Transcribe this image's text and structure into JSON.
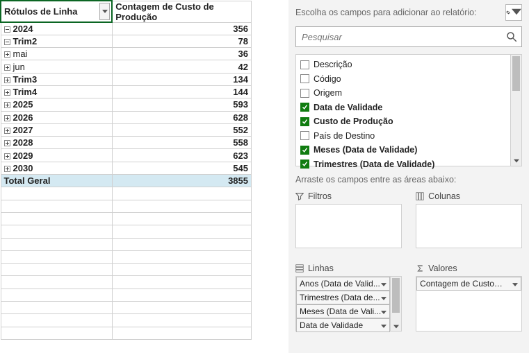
{
  "pivot": {
    "header_row": "Rótulos de Linha",
    "header_value": "Contagem de Custo de Produção",
    "rows": [
      {
        "label": "2024",
        "value": "356",
        "indent": 0,
        "icon": "minus",
        "bold": true
      },
      {
        "label": "Trim2",
        "value": "78",
        "indent": 1,
        "icon": "minus",
        "bold": true
      },
      {
        "label": "mai",
        "value": "36",
        "indent": 2,
        "icon": "plus",
        "bold": false
      },
      {
        "label": "jun",
        "value": "42",
        "indent": 2,
        "icon": "plus",
        "bold": false
      },
      {
        "label": "Trim3",
        "value": "134",
        "indent": 1,
        "icon": "plus",
        "bold": true
      },
      {
        "label": "Trim4",
        "value": "144",
        "indent": 1,
        "icon": "plus",
        "bold": true
      },
      {
        "label": "2025",
        "value": "593",
        "indent": 0,
        "icon": "plus",
        "bold": true
      },
      {
        "label": "2026",
        "value": "628",
        "indent": 0,
        "icon": "plus",
        "bold": true
      },
      {
        "label": "2027",
        "value": "552",
        "indent": 0,
        "icon": "plus",
        "bold": true
      },
      {
        "label": "2028",
        "value": "558",
        "indent": 0,
        "icon": "plus",
        "bold": true
      },
      {
        "label": "2029",
        "value": "623",
        "indent": 0,
        "icon": "plus",
        "bold": true
      },
      {
        "label": "2030",
        "value": "545",
        "indent": 0,
        "icon": "plus",
        "bold": true
      }
    ],
    "total_label": "Total Geral",
    "total_value": "3855"
  },
  "pane": {
    "choose_label": "Escolha os campos para adicionar ao relatório:",
    "search_placeholder": "Pesquisar",
    "fields": [
      {
        "label": "Descrição",
        "checked": false
      },
      {
        "label": "Código",
        "checked": false
      },
      {
        "label": "Origem",
        "checked": false
      },
      {
        "label": "Data de Validade",
        "checked": true
      },
      {
        "label": "Custo de Produção",
        "checked": true
      },
      {
        "label": "País de Destino",
        "checked": false
      },
      {
        "label": "Meses (Data de Validade)",
        "checked": true
      },
      {
        "label": "Trimestres (Data de Validade)",
        "checked": true
      }
    ],
    "drag_label": "Arraste os campos entre as áreas abaixo:",
    "areas": {
      "filters": "Filtros",
      "columns": "Colunas",
      "rows": "Linhas",
      "values": "Valores",
      "rows_items": [
        "Anos (Data de Valid...",
        "Trimestres (Data de...",
        "Meses (Data de Vali...",
        "Data de Validade"
      ],
      "values_items": [
        "Contagem de Custo de ..."
      ]
    }
  }
}
